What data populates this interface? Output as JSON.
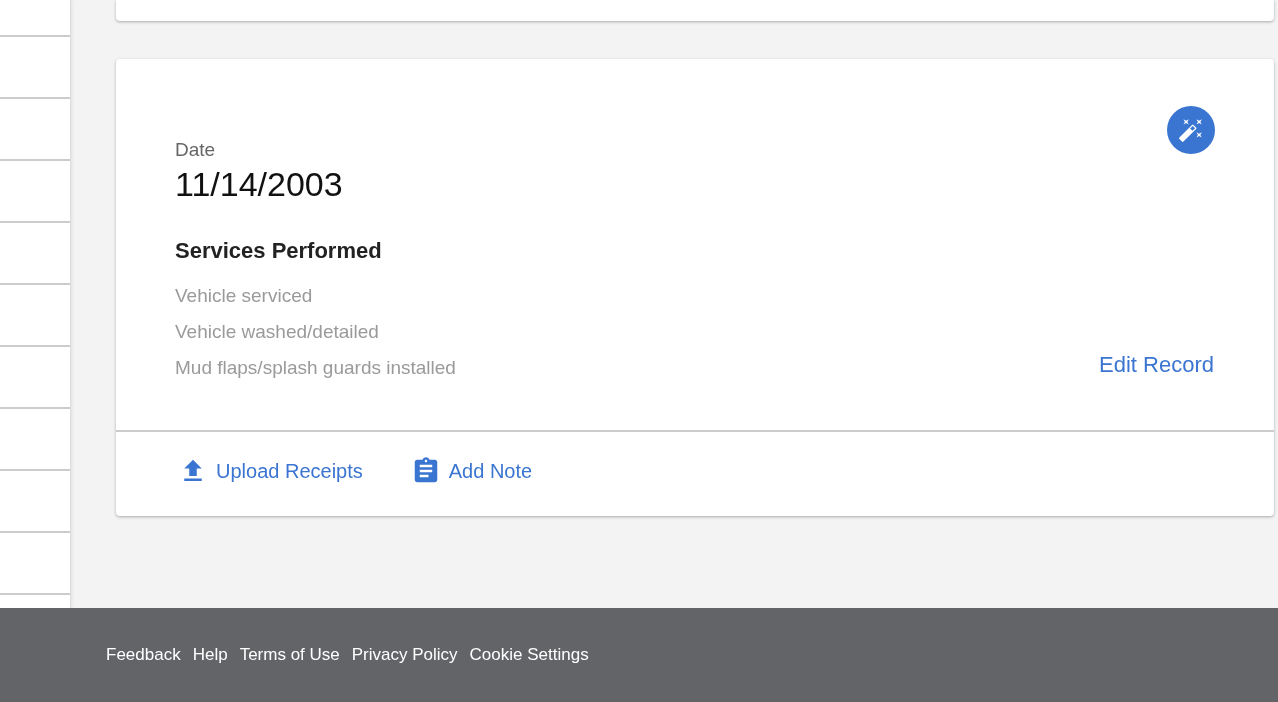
{
  "record": {
    "date_label": "Date",
    "date": "11/14/2003",
    "services_title": "Services Performed",
    "services": [
      "Vehicle serviced",
      "Vehicle washed/detailed",
      "Mud flaps/splash guards installed"
    ],
    "edit_link": "Edit Record"
  },
  "actions": [
    {
      "kind": "upload",
      "label": "Upload Receipts"
    },
    {
      "kind": "note",
      "label": "Add Note"
    }
  ],
  "footer": {
    "links": [
      "Feedback",
      "Help",
      "Terms of Use",
      "Privacy Policy",
      "Cookie Settings"
    ]
  }
}
